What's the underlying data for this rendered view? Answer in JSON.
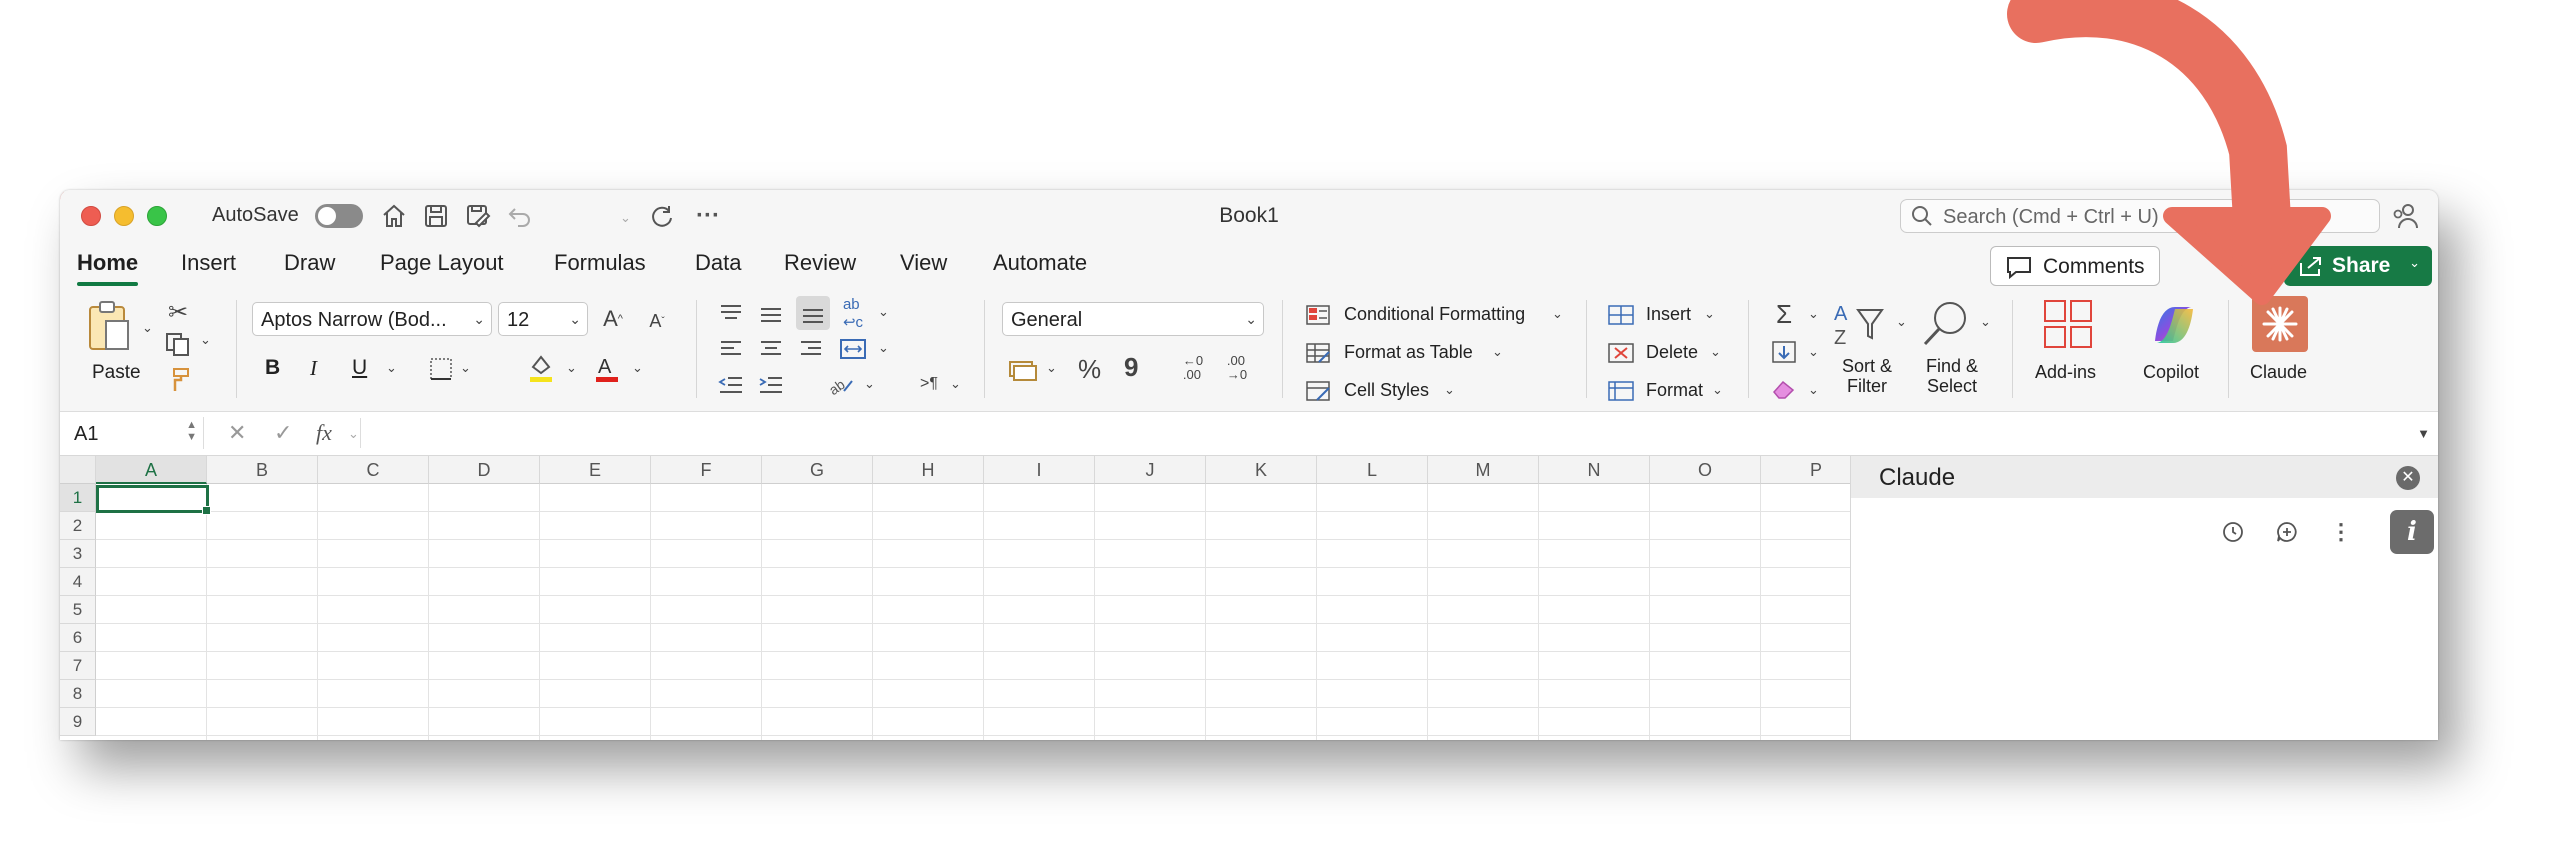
{
  "titlebar": {
    "autosave_label": "AutoSave",
    "autosave_on": false,
    "window_title": "Book1",
    "search_placeholder": "Search (Cmd + Ctrl + U)",
    "icons": [
      "home-icon",
      "save-icon",
      "save-as-icon",
      "undo-icon",
      "redo-icon",
      "more-icon"
    ]
  },
  "tabs": [
    {
      "label": "Home",
      "active": true
    },
    {
      "label": "Insert"
    },
    {
      "label": "Draw"
    },
    {
      "label": "Page Layout"
    },
    {
      "label": "Formulas"
    },
    {
      "label": "Data"
    },
    {
      "label": "Review"
    },
    {
      "label": "View"
    },
    {
      "label": "Automate"
    }
  ],
  "actions": {
    "comments_label": "Comments",
    "share_label": "Share",
    "share_color": "#177a45"
  },
  "ribbon": {
    "paste_label": "Paste",
    "font_name": "Aptos Narrow (Bod...",
    "font_size": "12",
    "number_format": "General",
    "conditional_formatting": "Conditional Formatting",
    "format_as_table": "Format as Table",
    "cell_styles": "Cell Styles",
    "insert": "Insert",
    "delete": "Delete",
    "format": "Format",
    "sort_filter": "Sort &\nFilter",
    "find_select": "Find &\nSelect",
    "addins": "Add-ins",
    "copilot": "Copilot",
    "claude": "Claude",
    "bold": "B",
    "italic": "I",
    "underline": "U",
    "percent": "%",
    "comma": "9"
  },
  "formula_bar": {
    "name_box": "A1",
    "fx": "fx",
    "formula": ""
  },
  "grid": {
    "columns": [
      "A",
      "B",
      "C",
      "D",
      "E",
      "F",
      "G",
      "H",
      "I",
      "J",
      "K",
      "L",
      "M",
      "N",
      "O",
      "P"
    ],
    "rows": [
      "1",
      "2",
      "3",
      "4",
      "5",
      "6",
      "7",
      "8",
      "9"
    ],
    "active_cell": "A1",
    "accent": "#1e7145"
  },
  "claude_pane": {
    "title": "Claude",
    "icons": [
      "history-icon",
      "new-chat-icon",
      "more-vertical-icon",
      "info-icon"
    ]
  },
  "annotation": {
    "arrow_color": "#e8705f",
    "points_to": "Claude"
  }
}
